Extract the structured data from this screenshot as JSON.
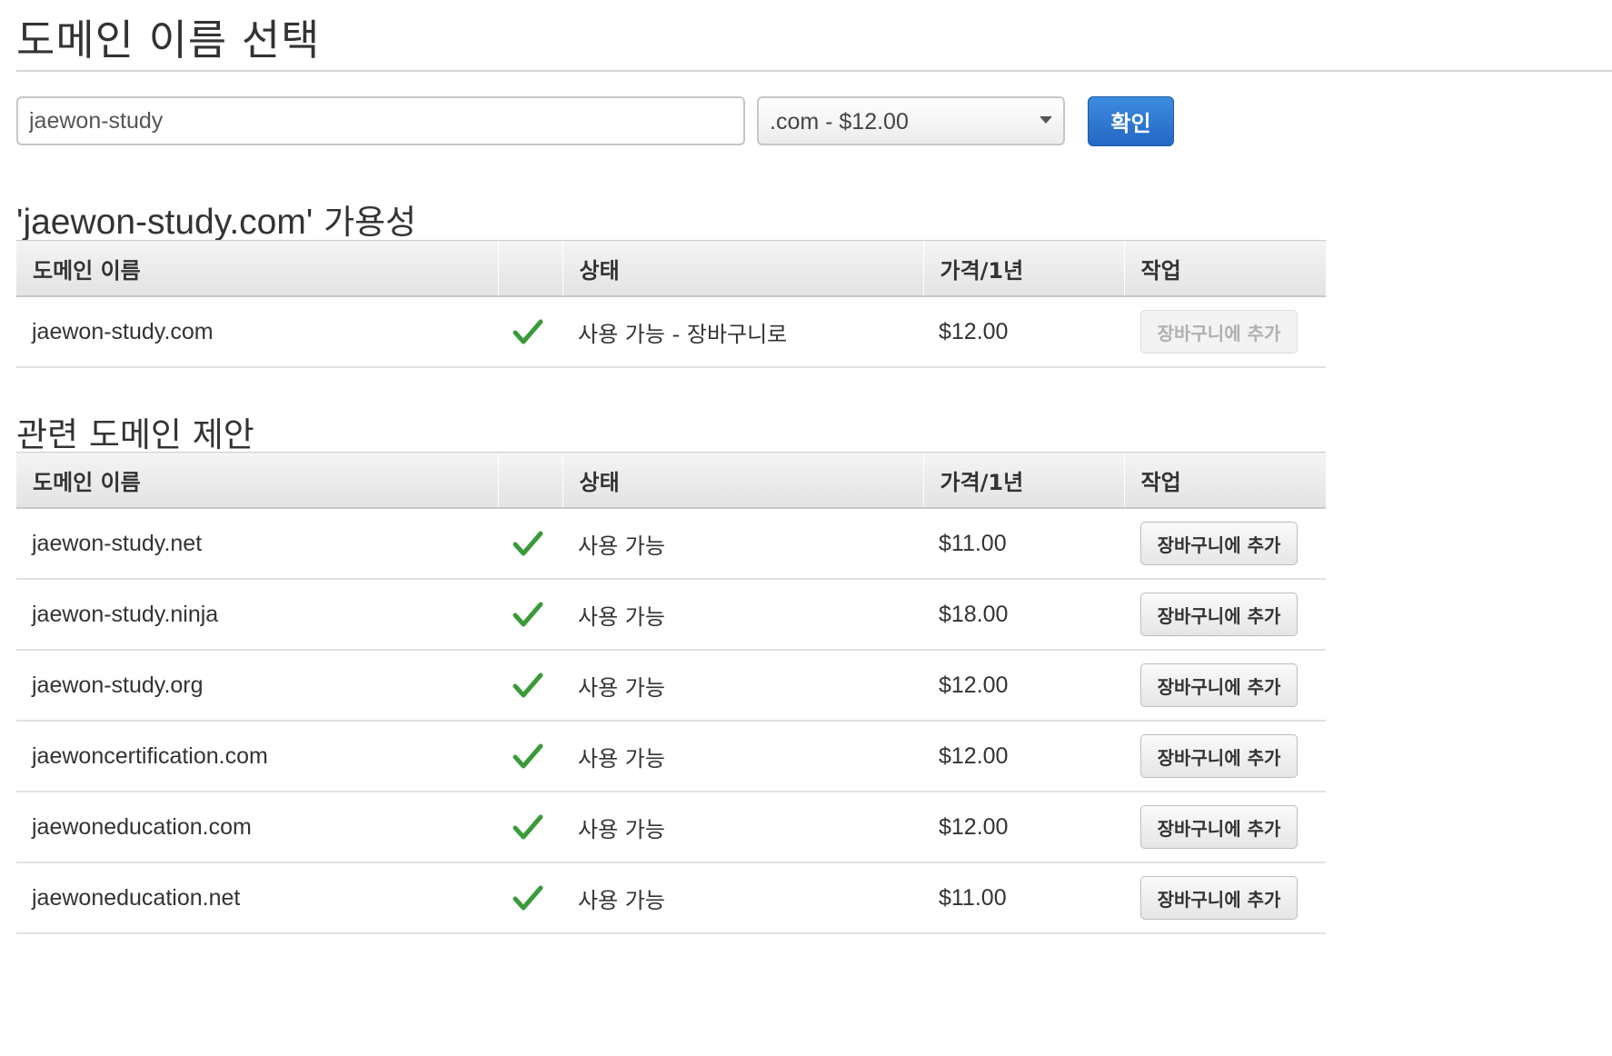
{
  "page_title": "도메인 이름 선택",
  "search": {
    "value": "jaewon-study",
    "tld_selected": ".com - $12.00",
    "confirm_label": "확인"
  },
  "availability": {
    "heading_domain": "'jaewon-study.com'",
    "heading_suffix": " 가용성",
    "columns": [
      "도메인 이름",
      "",
      "상태",
      "가격/1년",
      "작업"
    ],
    "row": {
      "domain": "jaewon-study.com",
      "status": "사용 가능 - 장바구니로",
      "price": "$12.00",
      "action": "장바구니에 추가",
      "action_disabled": true
    }
  },
  "suggestions": {
    "heading": "관련 도메인 제안",
    "columns": [
      "도메인 이름",
      "",
      "상태",
      "가격/1년",
      "작업"
    ],
    "rows": [
      {
        "domain": "jaewon-study.net",
        "status": "사용 가능",
        "price": "$11.00",
        "action": "장바구니에 추가"
      },
      {
        "domain": "jaewon-study.ninja",
        "status": "사용 가능",
        "price": "$18.00",
        "action": "장바구니에 추가"
      },
      {
        "domain": "jaewon-study.org",
        "status": "사용 가능",
        "price": "$12.00",
        "action": "장바구니에 추가"
      },
      {
        "domain": "jaewoncertification.com",
        "status": "사용 가능",
        "price": "$12.00",
        "action": "장바구니에 추가"
      },
      {
        "domain": "jaewoneducation.com",
        "status": "사용 가능",
        "price": "$12.00",
        "action": "장바구니에 추가"
      },
      {
        "domain": "jaewoneducation.net",
        "status": "사용 가능",
        "price": "$11.00",
        "action": "장바구니에 추가"
      }
    ]
  },
  "icons": {
    "available": "checkmark-icon",
    "dropdown": "chevron-down-icon"
  },
  "colors": {
    "accent": "#2467c4",
    "check": "#3a9a3a"
  }
}
